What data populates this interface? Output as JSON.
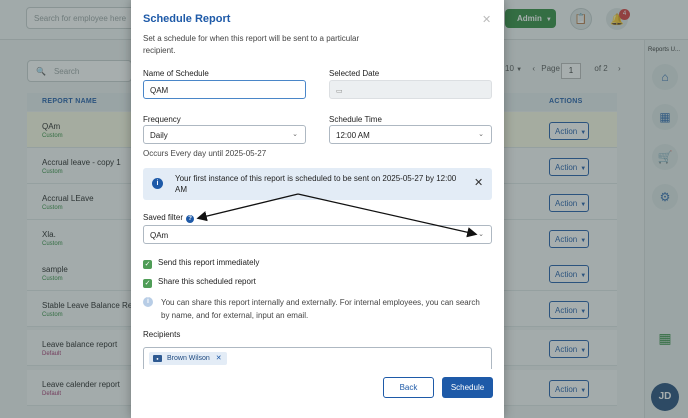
{
  "topbar": {
    "search_placeholder": "Search for employee here",
    "admin_label": "Admin",
    "notification_count": "4"
  },
  "right_rail": {
    "title": "Reports U...",
    "avatar_initials": "JD"
  },
  "list": {
    "search_placeholder": "Search",
    "pager": {
      "per_page": "10",
      "page_label": "Page",
      "current": "1",
      "of_label": "of 2"
    },
    "headers": {
      "name": "REPORT NAME",
      "actions": "ACTIONS"
    },
    "action_label": "Action",
    "rows": [
      {
        "name": "QAm",
        "tag": "Custom"
      },
      {
        "name": "Accrual leave - copy 1",
        "tag": "Custom"
      },
      {
        "name": "Accrual LEave",
        "tag": "Custom"
      },
      {
        "name": "Xla.",
        "tag": "Custom"
      },
      {
        "name": "sample",
        "tag": "Custom"
      },
      {
        "name": "Stable Leave Balance Rep",
        "tag": "Custom"
      },
      {
        "name": "Leave balance report",
        "tag": "Default"
      },
      {
        "name": "Leave calender report",
        "tag": "Default"
      }
    ]
  },
  "modal": {
    "title": "Schedule Report",
    "subtitle": "Set a schedule for when this report will be sent to a particular recipient.",
    "name_label": "Name of Schedule",
    "name_value": "QAM",
    "date_label": "Selected Date",
    "frequency_label": "Frequency",
    "frequency_value": "Daily",
    "time_label": "Schedule Time",
    "time_value": "12:00 AM",
    "occurs_text": "Occurs Every day until 2025-05-27",
    "info_text": "Your first instance of this report is scheduled to be sent on 2025-05-27 by 12:00 AM",
    "saved_filter_label": "Saved filter",
    "saved_filter_value": "QAm",
    "send_immediately_label": "Send this report immediately",
    "share_label": "Share this scheduled report",
    "share_info": "You can share this report internally and externally. For internal employees, you can search by name, and for external, input an email.",
    "recipients_label": "Recipients",
    "recipient_chip": "Brown Wilson",
    "back_label": "Back",
    "schedule_label": "Schedule"
  },
  "colors": {
    "primary": "#1e5aa8",
    "success": "#2e8a3d",
    "checkbox": "#4f9d57",
    "info_bg": "#e3ecf6"
  }
}
